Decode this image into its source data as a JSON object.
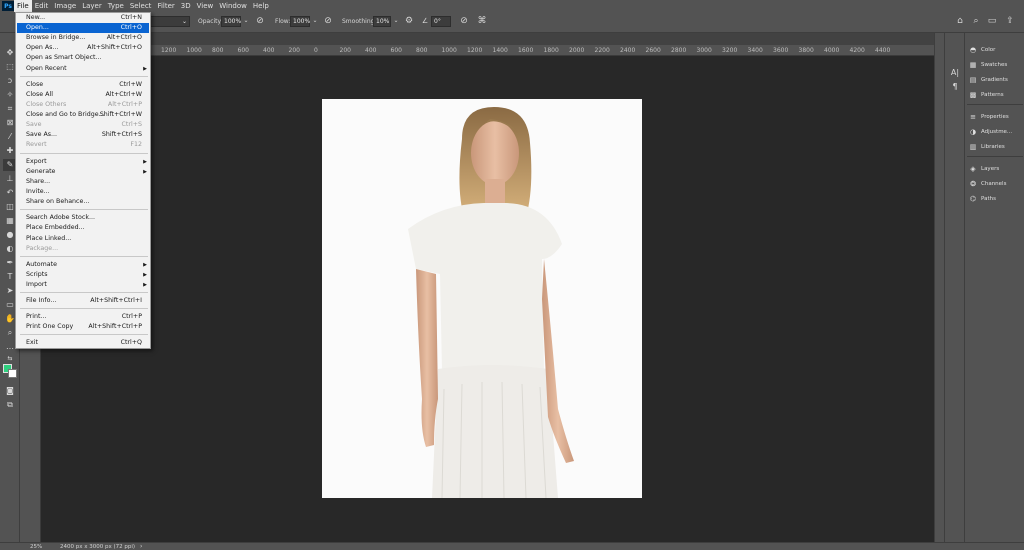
{
  "app": {
    "logo": "Ps"
  },
  "menubar": [
    "File",
    "Edit",
    "Image",
    "Layer",
    "Type",
    "Select",
    "Filter",
    "3D",
    "View",
    "Window",
    "Help"
  ],
  "options": {
    "opacity_label": "Opacity:",
    "opacity_value": "100%",
    "flow_label": "Flow:",
    "flow_value": "100%",
    "smoothing_label": "Smoothing:",
    "smoothing_value": "10%",
    "angle_value": "0°"
  },
  "ruler_ticks": [
    "1200",
    "1000",
    "800",
    "600",
    "400",
    "200",
    "0",
    "200",
    "400",
    "600",
    "800",
    "1000",
    "1200",
    "1400",
    "1600",
    "1800",
    "2000",
    "2200",
    "2400",
    "2600",
    "2800",
    "3000",
    "3200",
    "3400",
    "3600",
    "3800",
    "4000",
    "4200",
    "4400"
  ],
  "file_menu": {
    "new": {
      "label": "New...",
      "shortcut": "Ctrl+N"
    },
    "open": {
      "label": "Open...",
      "shortcut": "Ctrl+O"
    },
    "browse": {
      "label": "Browse in Bridge...",
      "shortcut": "Alt+Ctrl+O"
    },
    "open_as": {
      "label": "Open As...",
      "shortcut": "Alt+Shift+Ctrl+O"
    },
    "open_smart": {
      "label": "Open as Smart Object..."
    },
    "open_recent": {
      "label": "Open Recent"
    },
    "close": {
      "label": "Close",
      "shortcut": "Ctrl+W"
    },
    "close_all": {
      "label": "Close All",
      "shortcut": "Alt+Ctrl+W"
    },
    "close_others": {
      "label": "Close Others",
      "shortcut": "Alt+Ctrl+P"
    },
    "close_bridge": {
      "label": "Close and Go to Bridge...",
      "shortcut": "Shift+Ctrl+W"
    },
    "save": {
      "label": "Save",
      "shortcut": "Ctrl+S"
    },
    "save_as": {
      "label": "Save As...",
      "shortcut": "Shift+Ctrl+S"
    },
    "revert": {
      "label": "Revert",
      "shortcut": "F12"
    },
    "export": {
      "label": "Export"
    },
    "generate": {
      "label": "Generate"
    },
    "share": {
      "label": "Share..."
    },
    "invite": {
      "label": "Invite..."
    },
    "behance": {
      "label": "Share on Behance..."
    },
    "stock": {
      "label": "Search Adobe Stock..."
    },
    "place_embedded": {
      "label": "Place Embedded..."
    },
    "place_linked": {
      "label": "Place Linked..."
    },
    "package": {
      "label": "Package..."
    },
    "automate": {
      "label": "Automate"
    },
    "scripts": {
      "label": "Scripts"
    },
    "import": {
      "label": "Import"
    },
    "file_info": {
      "label": "File Info...",
      "shortcut": "Alt+Shift+Ctrl+I"
    },
    "print": {
      "label": "Print...",
      "shortcut": "Ctrl+P"
    },
    "print_one": {
      "label": "Print One Copy",
      "shortcut": "Alt+Shift+Ctrl+P"
    },
    "exit": {
      "label": "Exit",
      "shortcut": "Ctrl+Q"
    }
  },
  "panels": {
    "color": "Color",
    "swatches": "Swatches",
    "gradients": "Gradients",
    "patterns": "Patterns",
    "properties": "Properties",
    "adjustments": "Adjustme...",
    "libraries": "Libraries",
    "layers": "Layers",
    "channels": "Channels",
    "paths": "Paths"
  },
  "status": {
    "zoom": "25%",
    "doc_info": "2400 px x 3000 px (72 ppi)"
  },
  "colors": {
    "foreground": "#2fd07f",
    "background": "#ffffff",
    "highlight": "#0a64d1"
  }
}
